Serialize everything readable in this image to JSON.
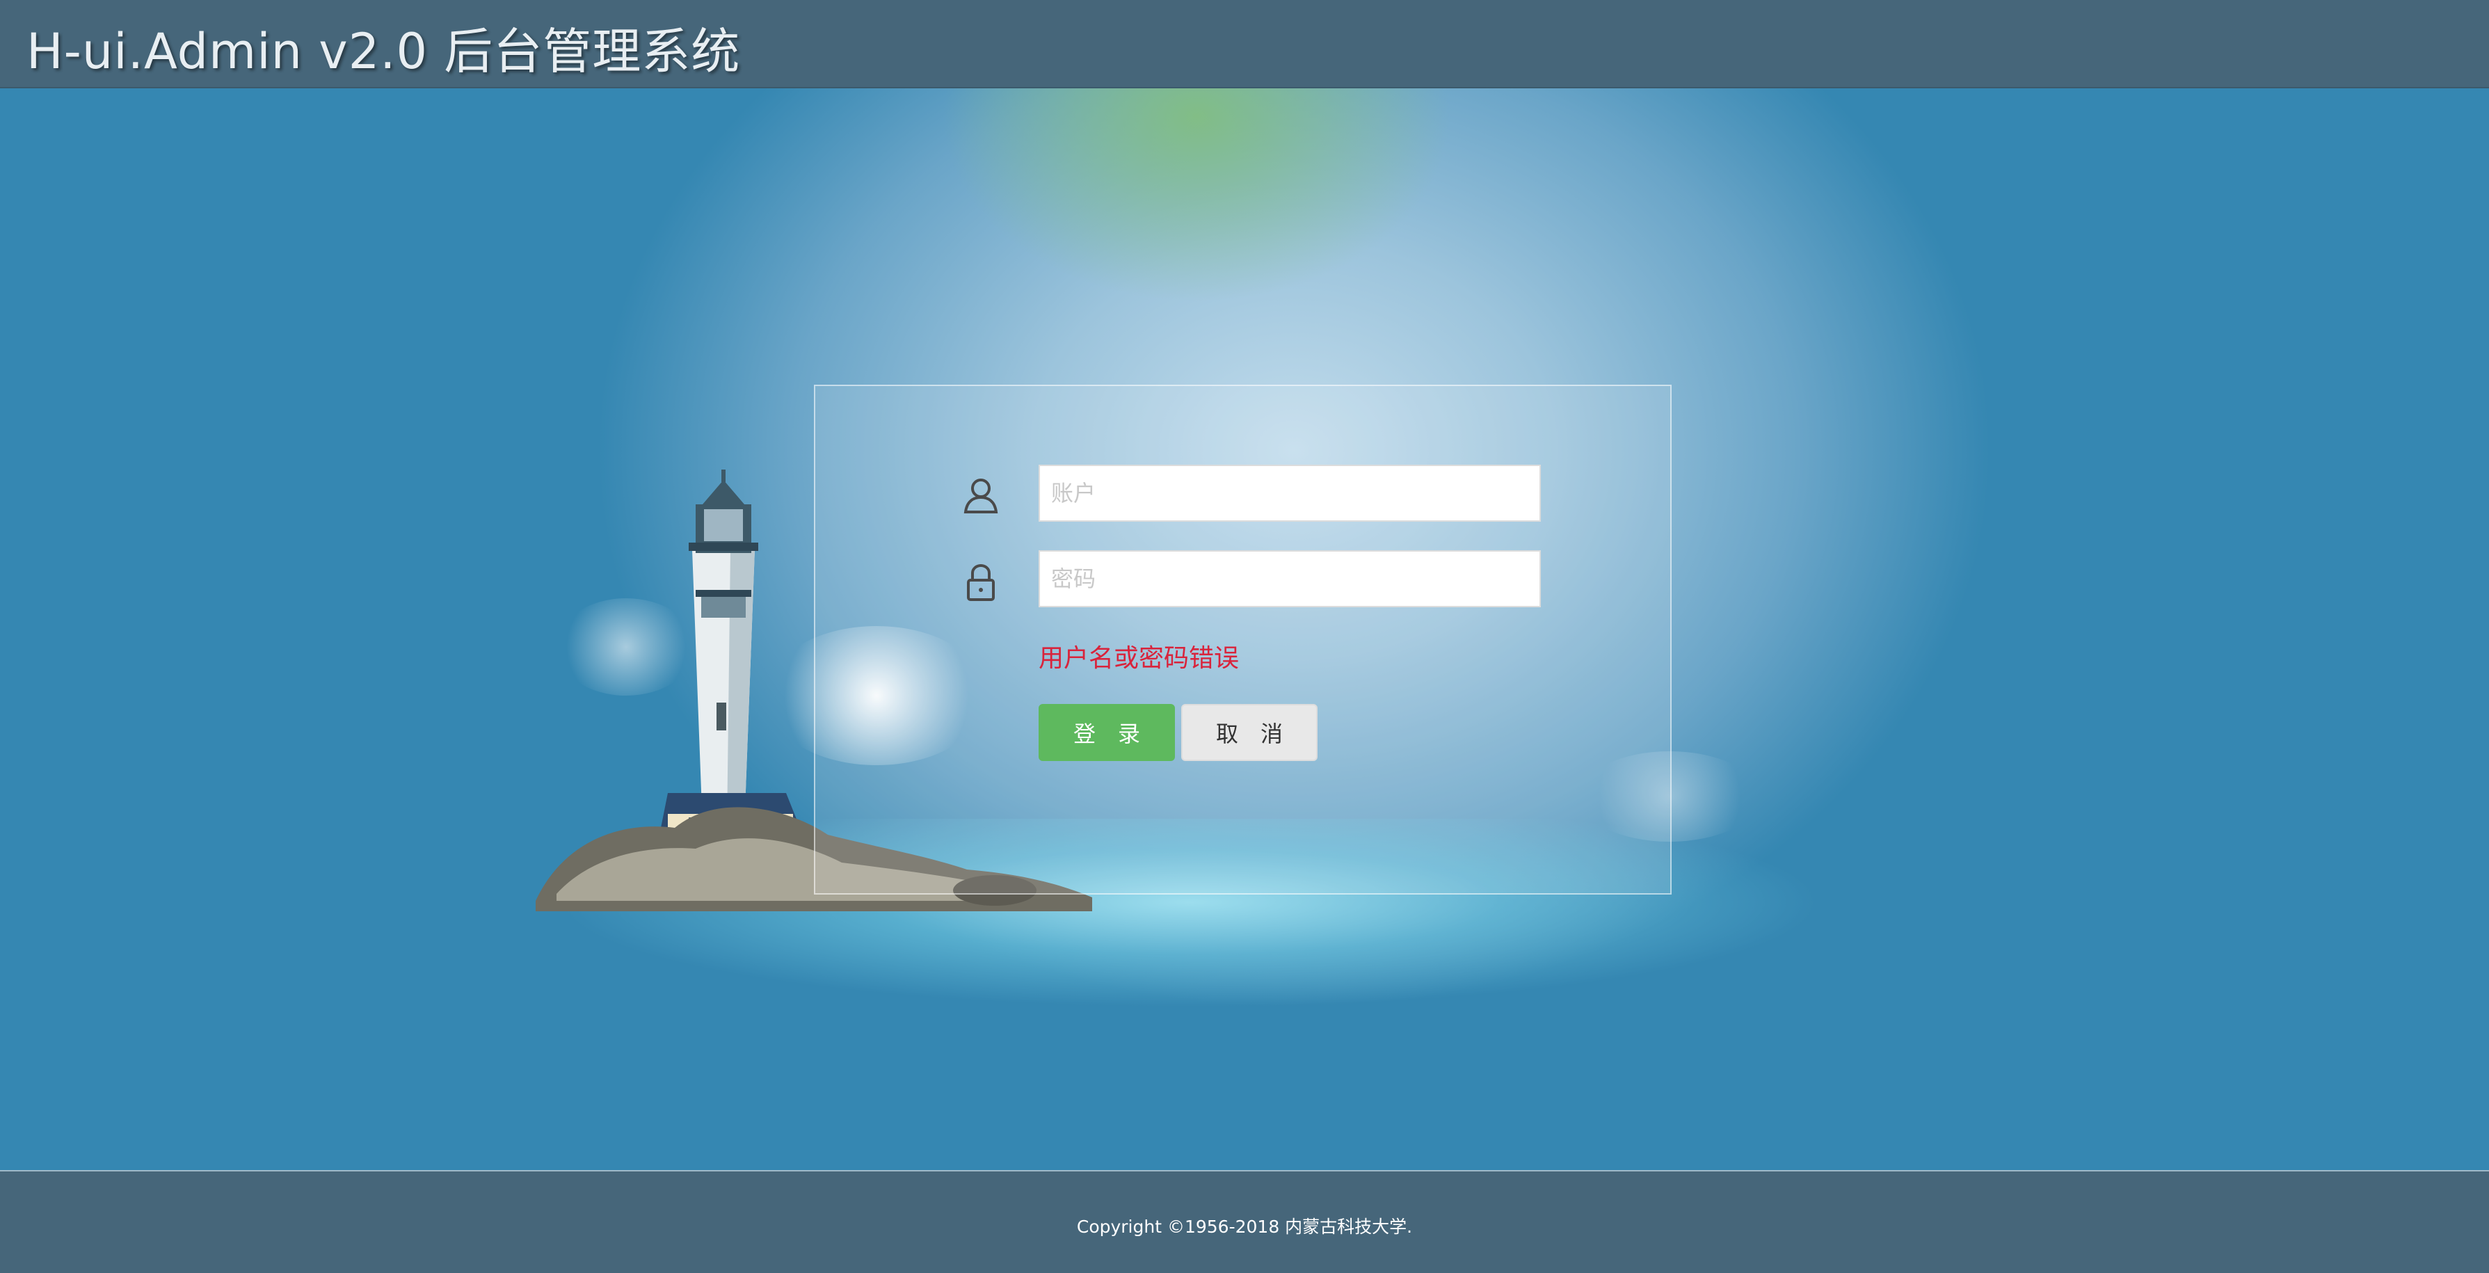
{
  "header": {
    "title": "H-ui.Admin v2.0 后台管理系统"
  },
  "login_form": {
    "username": {
      "placeholder": "账户",
      "value": "",
      "icon": "user-icon"
    },
    "password": {
      "placeholder": "密码",
      "value": "",
      "icon": "lock-icon"
    },
    "error_message": "用户名或密码错误",
    "login_button": "登　录",
    "cancel_button": "取　消"
  },
  "footer": {
    "copyright": "Copyright ©1956-2018 内蒙古科技大学."
  },
  "colors": {
    "header_bg": "#46667a",
    "background": "#3587b2",
    "error": "#d9233b",
    "login_button": "#5eb95e",
    "cancel_button": "#e8e8e8"
  }
}
